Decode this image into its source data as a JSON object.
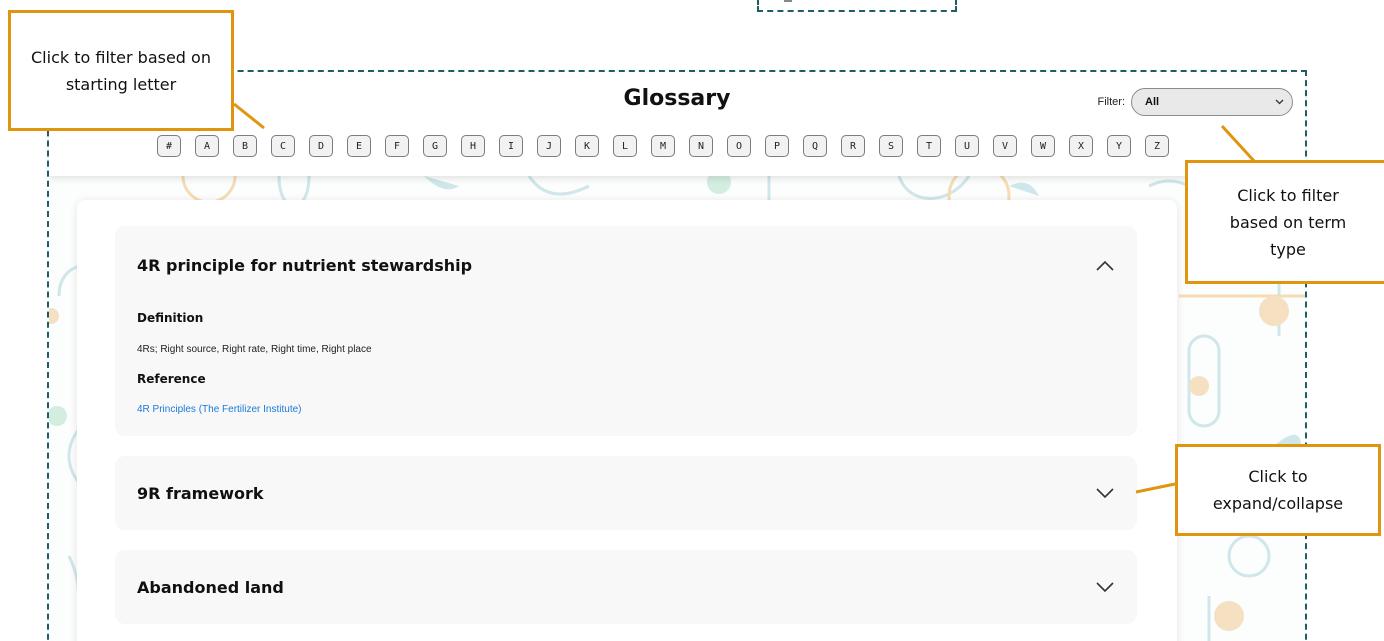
{
  "header": {
    "title": "Glossary",
    "filter_label": "Filter:",
    "filter_value": "All",
    "letters": [
      "#",
      "A",
      "B",
      "C",
      "D",
      "E",
      "F",
      "G",
      "H",
      "I",
      "J",
      "K",
      "L",
      "M",
      "N",
      "O",
      "P",
      "Q",
      "R",
      "S",
      "T",
      "U",
      "V",
      "W",
      "X",
      "Y",
      "Z"
    ]
  },
  "entries": [
    {
      "term": "4R principle for nutrient stewardship",
      "expanded": true,
      "definition_label": "Definition",
      "definition": "4Rs; Right source, Right rate, Right time, Right place",
      "reference_label": "Reference",
      "reference_link": "4R Principles (The Fertilizer Institute)",
      "chevron_icon": "chevron-up-icon"
    },
    {
      "term": "9R framework",
      "expanded": false,
      "chevron_icon": "chevron-down-icon"
    },
    {
      "term": "Abandoned land",
      "expanded": false,
      "chevron_icon": "chevron-down-icon"
    }
  ],
  "callouts": {
    "letter_filter": "Click to filter based on starting letter",
    "term_type_filter": "Click to filter based on term type",
    "expand_collapse": "Click to expand/collapse"
  },
  "colors": {
    "annotation_border": "#e0950f",
    "dashed_frame": "#1e5e64",
    "link": "#1a7ad8"
  }
}
